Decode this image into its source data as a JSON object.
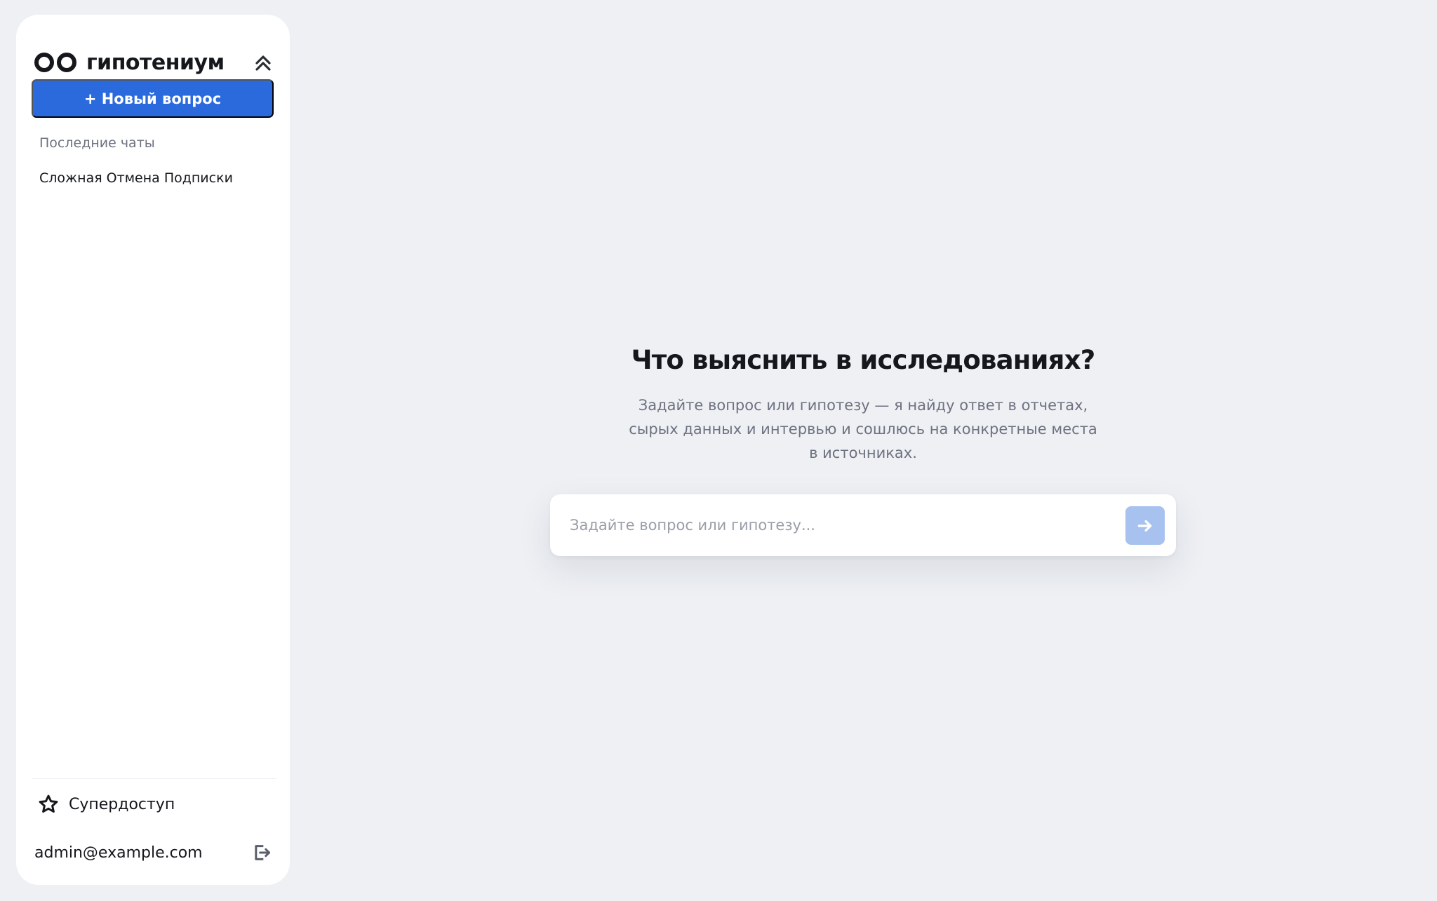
{
  "brand": {
    "name": "гипотениум"
  },
  "sidebar": {
    "new_question_label": "+ Новый вопрос",
    "recent_title": "Последние чаты",
    "chats": [
      {
        "label": "Сложная Отмена Подписки"
      }
    ],
    "superaccess_label": "Супердоступ",
    "user_email": "admin@example.com"
  },
  "main": {
    "title": "Что выяснить в исследованиях?",
    "subtitle_lines": [
      "Задайте вопрос или гипотезу — я найду ответ в отчетах,",
      "сырых данных и интервью и сошлюсь на конкретные места",
      "в источниках."
    ],
    "input_placeholder": "Задайте вопрос или гипотезу...",
    "input_value": ""
  },
  "icons": {
    "collapse": "double-chevron-up-icon",
    "superaccess": "star-icon",
    "logout": "logout-icon",
    "send": "arrow-right-icon"
  },
  "colors": {
    "background": "#eef0f4",
    "sidebar": "#ffffff",
    "primary_button": "#2a6add",
    "send_button_disabled": "#a8c2f0",
    "text_primary": "#15171c",
    "text_muted": "#6d7280"
  }
}
